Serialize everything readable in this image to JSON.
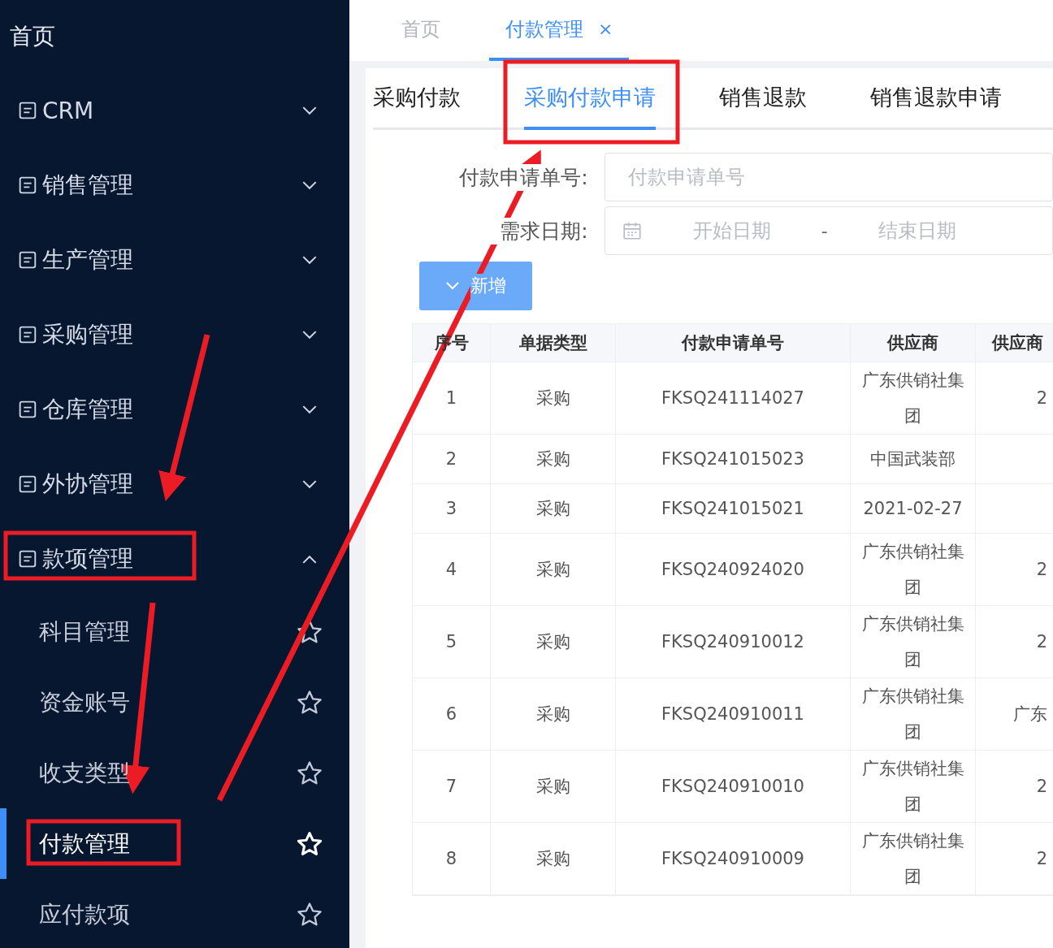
{
  "sidebar": {
    "home": "首页",
    "menus": [
      {
        "label": "CRM",
        "expanded": false
      },
      {
        "label": "销售管理",
        "expanded": false
      },
      {
        "label": "生产管理",
        "expanded": false
      },
      {
        "label": "采购管理",
        "expanded": false
      },
      {
        "label": "仓库管理",
        "expanded": false
      },
      {
        "label": "外协管理",
        "expanded": false
      },
      {
        "label": "款项管理",
        "expanded": true,
        "children": [
          {
            "label": "科目管理",
            "selected": false
          },
          {
            "label": "资金账号",
            "selected": false
          },
          {
            "label": "收支类型",
            "selected": false
          },
          {
            "label": "付款管理",
            "selected": true
          },
          {
            "label": "应付款项",
            "selected": false
          }
        ]
      }
    ]
  },
  "page_tabs": [
    {
      "label": "首页",
      "selected": false,
      "closable": false
    },
    {
      "label": "付款管理",
      "selected": true,
      "closable": true,
      "close": "×"
    }
  ],
  "sub_tabs": [
    {
      "label": "采购付款",
      "selected": false
    },
    {
      "label": "采购付款申请",
      "selected": true
    },
    {
      "label": "销售退款",
      "selected": false
    },
    {
      "label": "销售退款申请",
      "selected": false
    }
  ],
  "form": {
    "number_label": "付款申请单号:",
    "number_placeholder": "付款申请单号",
    "date_label": "需求日期:",
    "start_placeholder": "开始日期",
    "separator": "-",
    "end_placeholder": "结束日期"
  },
  "add_button": "新增",
  "table": {
    "columns": [
      "序号",
      "单据类型",
      "付款申请单号",
      "供应商",
      "供应商"
    ],
    "rows": [
      [
        "1",
        "采购",
        "FKSQ241114027",
        "广东供销社集团",
        "2"
      ],
      [
        "2",
        "采购",
        "FKSQ241015023",
        "中国武装部",
        ""
      ],
      [
        "3",
        "采购",
        "FKSQ241015021",
        "2021-02-27",
        ""
      ],
      [
        "4",
        "采购",
        "FKSQ240924020",
        "广东供销社集团",
        "2"
      ],
      [
        "5",
        "采购",
        "FKSQ240910012",
        "广东供销社集团",
        "2"
      ],
      [
        "6",
        "采购",
        "FKSQ240910011",
        "广东供销社集团",
        "广东"
      ],
      [
        "7",
        "采购",
        "FKSQ240910010",
        "广东供销社集团",
        "2"
      ],
      [
        "8",
        "采购",
        "FKSQ240910009",
        "广东供销社集团",
        "2"
      ]
    ]
  }
}
